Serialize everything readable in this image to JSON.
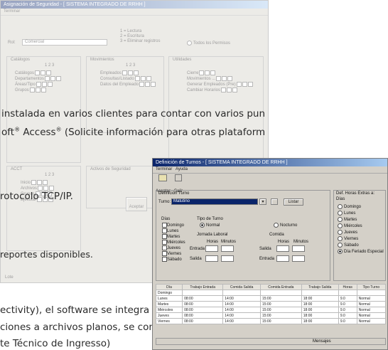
{
  "back_window": {
    "title": "Asignación de Seguridad - [ SISTEMA INTEGRADO DE RRHH ]",
    "menu": "Terminar",
    "rol_label": "Rol:",
    "rol_value": "Comercial",
    "permissions": [
      "1 = Lectura",
      "2 = Escritura",
      "3 = Eliminar registros"
    ],
    "all_perms_label": "Todos los Permisos",
    "groups": [
      "Catálogos",
      "Movimientos",
      "Utilidades"
    ],
    "col_header": "1 2 3",
    "catalog_items": [
      "Catálogos",
      "Departamentos",
      "Áreas/Tipo",
      "Grupos"
    ],
    "mov_items": [
      "Empleados",
      "Consultas/Listado",
      "Datos del Empleado"
    ],
    "util_items": [
      "Cierre",
      "Movimientos ...",
      "Generar Empleados (Pre)",
      "Cambiar Horarios"
    ],
    "lower_groups": [
      "ACCT",
      "Activos de Seguridad"
    ],
    "lower_items": [
      "Inicio",
      "Archivos",
      "Grupos",
      "Ejecutar"
    ],
    "ok_button": "Aceptar",
    "footer_left": "Lote"
  },
  "document_text": {
    "line1": "instalada en varios clientes para contar con varios pun",
    "line2_prefix": "oft",
    "line2_access": " Access",
    "line2_rest": " (Solicite información para otras plataform",
    "reg": "®",
    "line3": "rotocolo TCP/IP.",
    "line4": "reportes disponibles.",
    "line5": "ectivity), el software se integra fácilmente con diverso",
    "line6": "ciones a archivos planos, se comunica fácilmente con d",
    "line7": "te Técnico de Ingresso)"
  },
  "front_window": {
    "title": "Definición de Turnos - [ SISTEMA INTEGRADO DE RRHH ]",
    "menu": [
      "Terminar",
      "Ayuda"
    ],
    "toolbar": [
      "Aceptar",
      "Salir"
    ],
    "section_title": "Definición Turno",
    "turno_label": "Turno:",
    "turno_value": "Matutino",
    "find_button": "Listar",
    "right_title": "Def. Horas Extras a:",
    "right_sub": "Días",
    "days": [
      "Domingo",
      "Lunes",
      "Martes",
      "Miércoles",
      "Jueves",
      "Viernes",
      "Sábado",
      "Día Feriado Especial"
    ],
    "dias_label": "Días",
    "dias_list": [
      "Domingo",
      "Lunes",
      "Martes",
      "Miércoles",
      "Jueves",
      "Viernes",
      "Sábado"
    ],
    "tipo_turno_label": "Tipo de Turno",
    "tipo_normal": "Normal",
    "tipo_nocturno": "Nocturno",
    "jornada_label": "Jornada Laboral",
    "comida_label": "Comida",
    "horas_label": "Horas",
    "minutos_label": "Minutos",
    "entrada_label": "Entrada",
    "salida_label": "Salida",
    "table_headers": [
      "Día",
      "Trabajo Entrada",
      "Comida Salida",
      "Comida Entrada",
      "Trabajo Salida",
      "Horas",
      "Tipo Turno"
    ],
    "table_rows": [
      [
        "Domingo",
        "",
        "",
        "",
        "",
        "",
        ""
      ],
      [
        "Lunes",
        "08:00",
        "14:00",
        "15:00",
        "18:00",
        "9.0",
        "Normal"
      ],
      [
        "Martes",
        "08:00",
        "14:00",
        "15:00",
        "18:00",
        "9.0",
        "Normal"
      ],
      [
        "Miércoles",
        "08:00",
        "14:00",
        "15:00",
        "18:00",
        "9.0",
        "Normal"
      ],
      [
        "Jueves",
        "08:00",
        "14:00",
        "15:00",
        "18:00",
        "9.0",
        "Normal"
      ],
      [
        "Viernes",
        "08:00",
        "14:00",
        "15:00",
        "18:00",
        "9.0",
        "Normal"
      ]
    ],
    "status": "Mensajes"
  }
}
